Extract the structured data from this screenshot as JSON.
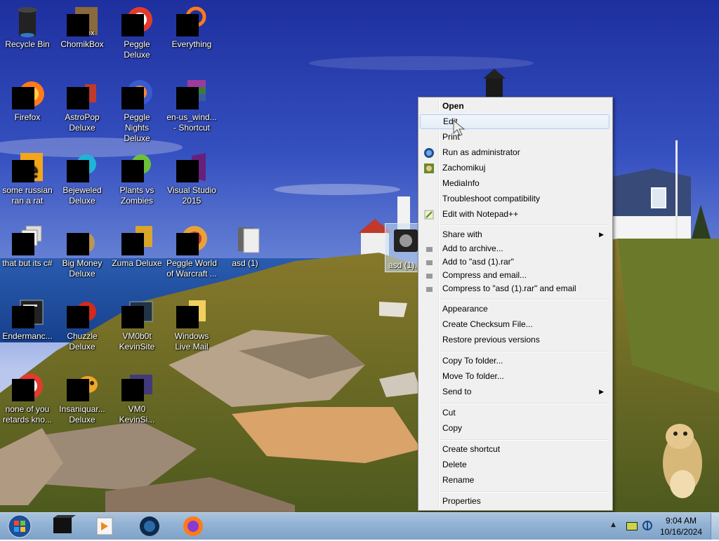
{
  "desktop": {
    "icons": [
      {
        "label": "Recycle Bin"
      },
      {
        "label": "ChomikBox"
      },
      {
        "label": "Peggle Deluxe"
      },
      {
        "label": "Everything"
      },
      {
        "label": "Firefox"
      },
      {
        "label": "AstroPop Deluxe"
      },
      {
        "label": "Peggle Nights Deluxe"
      },
      {
        "label": "en-us_wind... - Shortcut"
      },
      {
        "label": "some russian ran a rat"
      },
      {
        "label": "Bejeweled Deluxe"
      },
      {
        "label": "Plants vs Zombies"
      },
      {
        "label": "Visual Studio 2015"
      },
      {
        "label": "that but its c#"
      },
      {
        "label": "Big Money Deluxe"
      },
      {
        "label": "Zuma Deluxe"
      },
      {
        "label": "Peggle World of Warcraft ..."
      },
      {
        "label": "asd (1)"
      },
      {
        "label": "Endermanc..."
      },
      {
        "label": "Chuzzle Deluxe"
      },
      {
        "label": "VM0b0t KevinSite"
      },
      {
        "label": "Windows Live Mail"
      },
      {
        "label": "none of you retards kno..."
      },
      {
        "label": "Insaniquar... Deluxe"
      },
      {
        "label": "VM0 KevinSi..."
      }
    ],
    "selected_file_label": "asd (1)..."
  },
  "context_menu": {
    "items": [
      {
        "label": "Open"
      },
      {
        "label": "Edit"
      },
      {
        "label": "Print"
      },
      {
        "label": "Run as administrator"
      },
      {
        "label": "Zachomikuj"
      },
      {
        "label": "MediaInfo"
      },
      {
        "label": "Troubleshoot compatibility"
      },
      {
        "label": "Edit with Notepad++"
      },
      {
        "label": "Share with"
      },
      {
        "label": "Add to archive..."
      },
      {
        "label": "Add to \"asd (1).rar\""
      },
      {
        "label": "Compress and email..."
      },
      {
        "label": "Compress to \"asd (1).rar\" and email"
      },
      {
        "label": "Appearance"
      },
      {
        "label": "Create Checksum File..."
      },
      {
        "label": "Restore previous versions"
      },
      {
        "label": "Copy To folder..."
      },
      {
        "label": "Move To folder..."
      },
      {
        "label": "Send to"
      },
      {
        "label": "Cut"
      },
      {
        "label": "Copy"
      },
      {
        "label": "Create shortcut"
      },
      {
        "label": "Delete"
      },
      {
        "label": "Rename"
      },
      {
        "label": "Properties"
      }
    ],
    "highlighted": "Edit",
    "submenu_arrow": "▶"
  },
  "taskbar": {
    "pinned": [
      "terminal-icon",
      "media-player-icon",
      "globe-icon",
      "firefox-icon"
    ],
    "tray": {
      "show_hidden": "▲"
    },
    "clock": {
      "time": "9:04 AM",
      "date": "10/16/2024"
    }
  },
  "colors": {
    "sky_top": "#2438a8",
    "sea": "#1f4fa0",
    "menu_bg": "#f0f0f0",
    "menu_hover_border": "#aecff7",
    "taskbar": "#8fb0d2"
  }
}
